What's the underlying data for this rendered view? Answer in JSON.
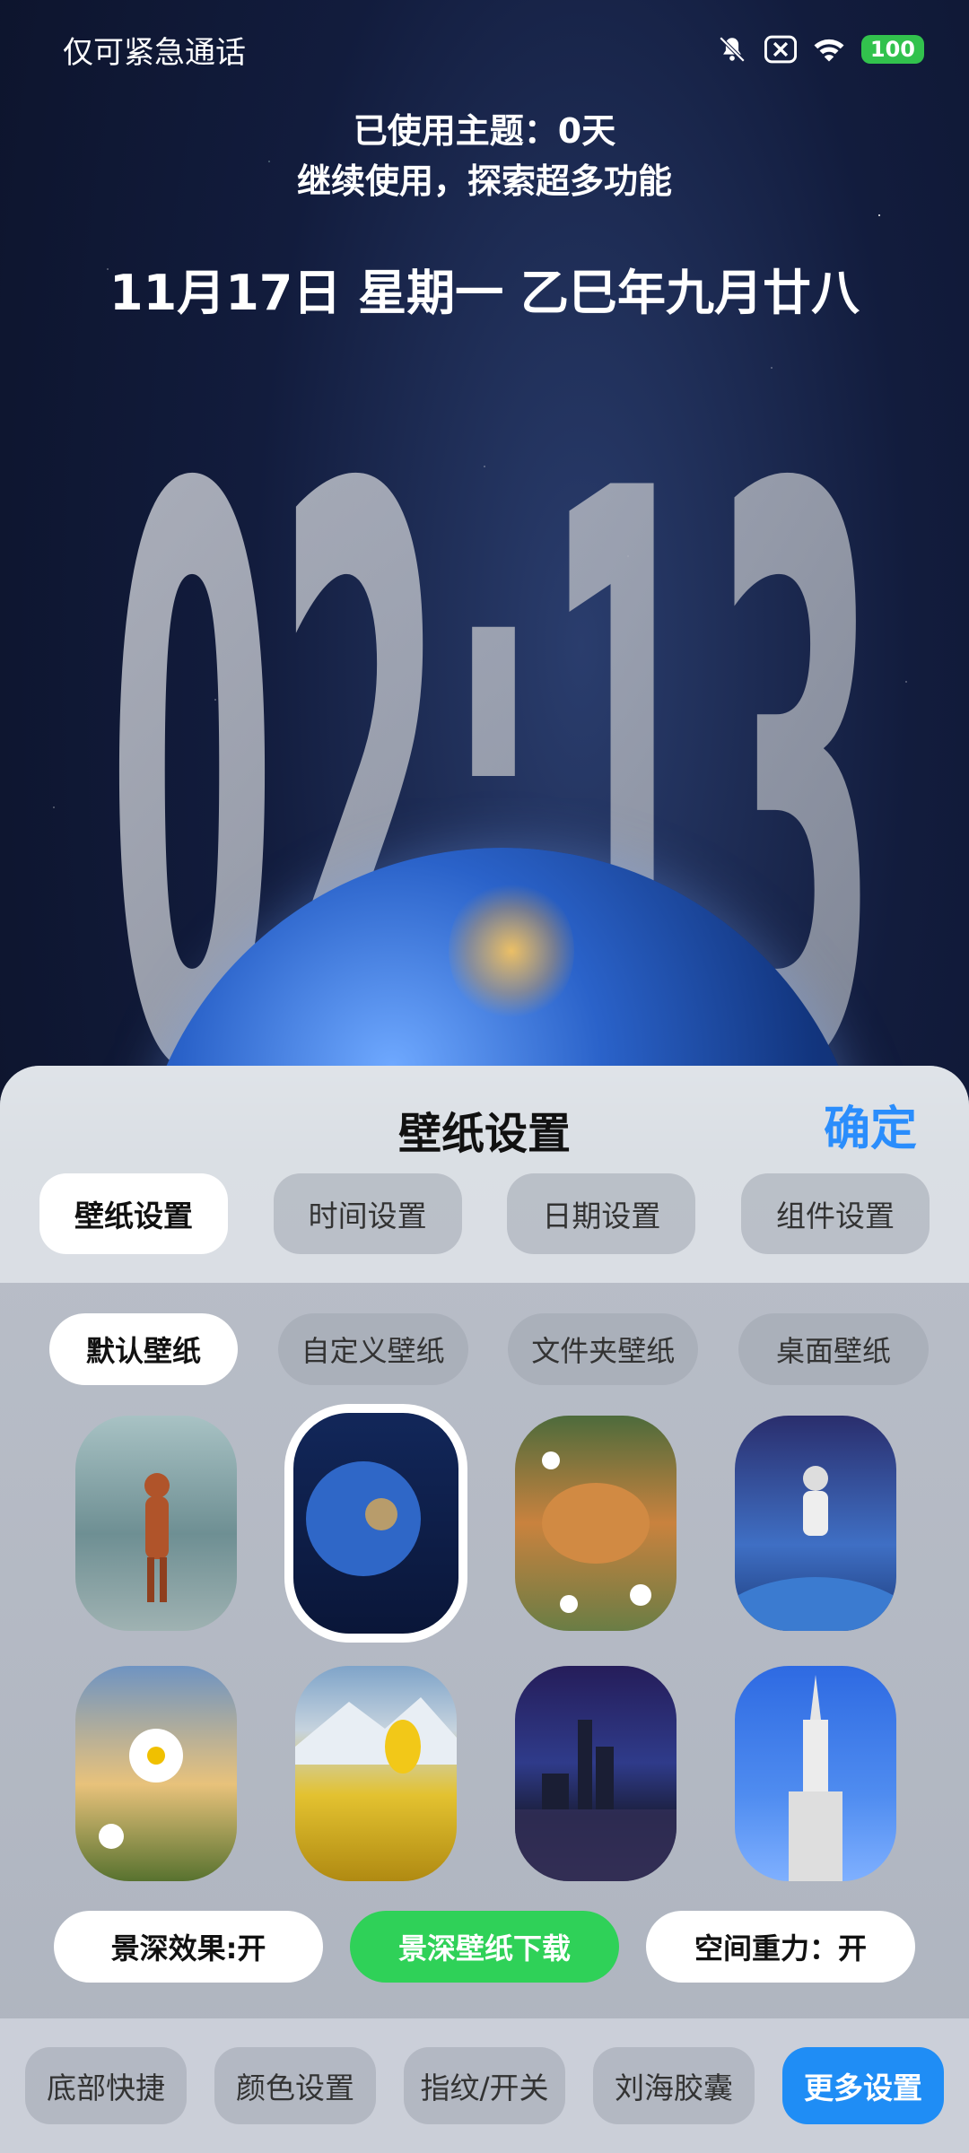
{
  "status": {
    "carrier_text": "仅可紧急通话",
    "battery": "100",
    "icons": [
      "bell-muted-icon",
      "close-box-icon",
      "wifi-icon"
    ]
  },
  "lockscreen": {
    "promo_line1": "已使用主题：0天",
    "promo_line2": "继续使用，探索超多功能",
    "date_line": "11月17日 星期一 乙巳年九月廿八",
    "time": "02:13"
  },
  "panel": {
    "title": "壁纸设置",
    "confirm": "确定",
    "top_tabs": [
      "壁纸设置",
      "时间设置",
      "日期设置",
      "组件设置"
    ],
    "wallpaper_tabs": [
      "默认壁纸",
      "自定义壁纸",
      "文件夹壁纸",
      "桌面壁纸"
    ],
    "thumbnails": [
      {
        "name": "astronaut-forest-thumb",
        "selected": false
      },
      {
        "name": "earth-thumb",
        "selected": true
      },
      {
        "name": "cat-flowers-thumb",
        "selected": false
      },
      {
        "name": "astronaut-space-thumb",
        "selected": false
      },
      {
        "name": "daisy-sunset-thumb",
        "selected": false
      },
      {
        "name": "tulips-mountain-thumb",
        "selected": false
      },
      {
        "name": "city-night-thumb",
        "selected": false
      },
      {
        "name": "tower-sky-thumb",
        "selected": false
      }
    ],
    "toggles": [
      "景深效果:开",
      "景深壁纸下载",
      "空间重力：开"
    ],
    "bottom_tabs": [
      "底部快捷",
      "颜色设置",
      "指纹/开关",
      "刘海胶囊",
      "更多设置"
    ]
  },
  "colors": {
    "accent_blue": "#2a8dfc",
    "green": "#2fd158",
    "battery_green": "#32c24d"
  }
}
